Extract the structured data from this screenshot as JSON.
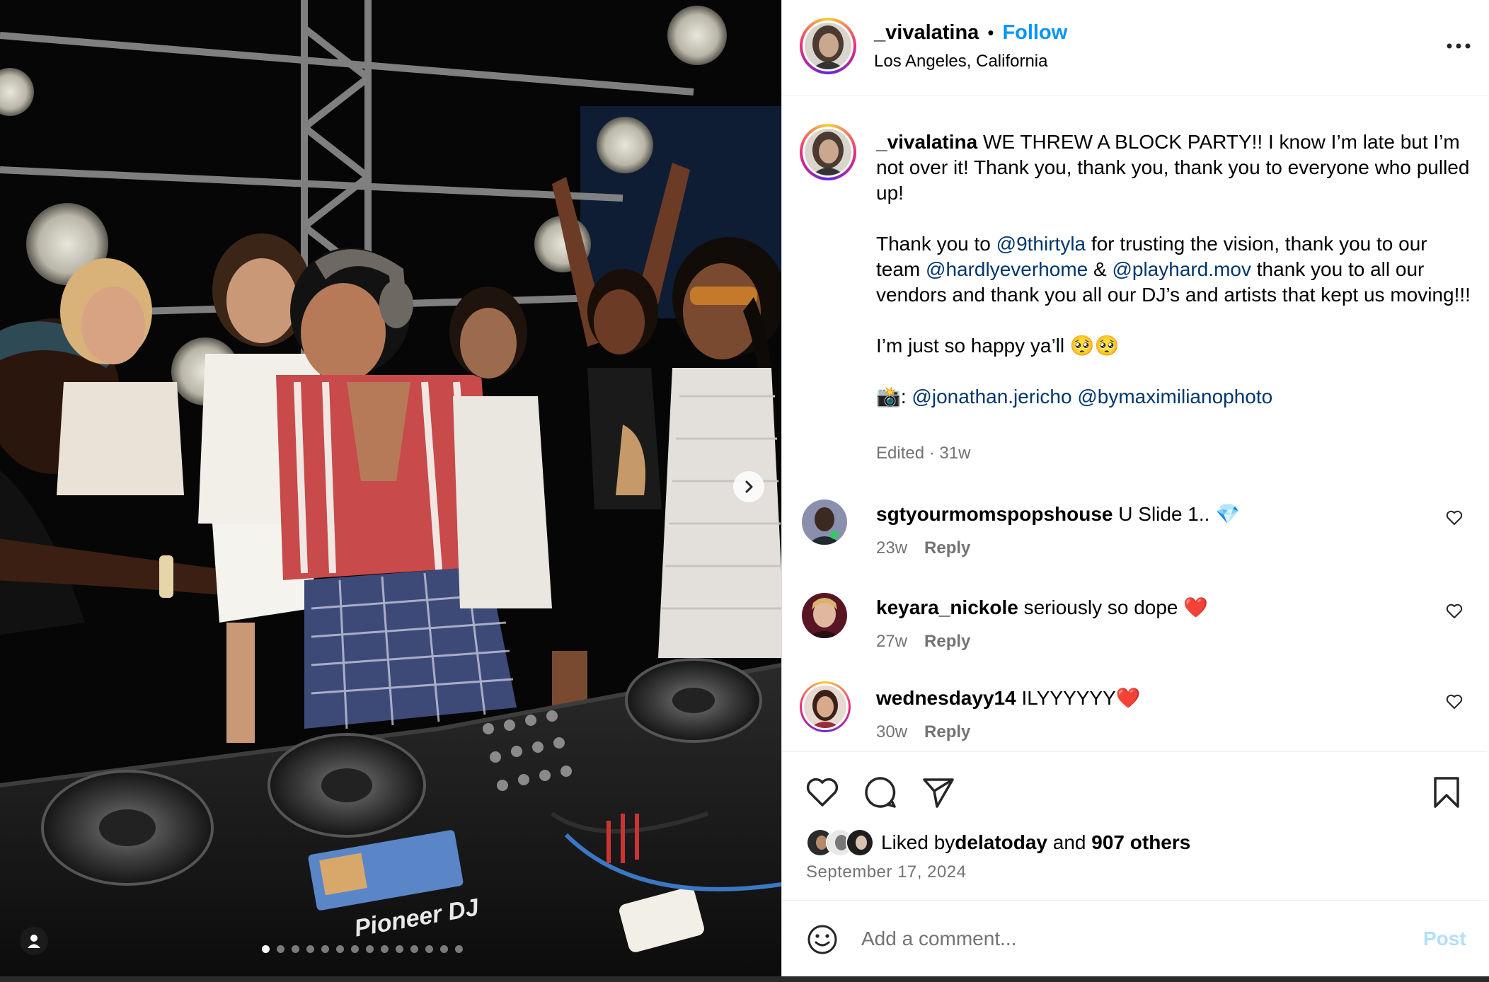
{
  "post": {
    "username": "_vivalatina",
    "separator": "•",
    "follow_label": "Follow",
    "location": "Los Angeles, California",
    "more_label": "More options"
  },
  "photo": {
    "carousel_count": 14,
    "active_index": 0,
    "brand_text": "Pioneer DJ"
  },
  "caption": {
    "username": "_vivalatina",
    "line1": " WE THREW A BLOCK PARTY!! I know I’m late but I’m not over it! Thank you, thank you, thank you to everyone who pulled up!",
    "p2_a": "Thank you to ",
    "m1": "@9thirtyla",
    "p2_b": " for trusting the vision, thank you to our team ",
    "m2": "@hardlyeverhome",
    "p2_c": " & ",
    "m3": "@playhard.mov",
    "p2_d": " thank you to all our vendors and thank you all our DJ’s and artists that kept us moving!!!",
    "p3": "I’m just so happy ya’ll 🥺🥺",
    "p4_prefix": "📸: ",
    "m4": "@jonathan.jericho",
    "p4_space": " ",
    "m5": "@bymaximilianophoto",
    "edited": "Edited · 31w"
  },
  "comments": [
    {
      "username": "sgtyourmomspopshouse",
      "text": " U Slide 1.. 💎",
      "age": "23w",
      "reply": "Reply"
    },
    {
      "username": "keyara_nickole",
      "text": " seriously so dope ❤️",
      "age": "27w",
      "reply": "Reply"
    },
    {
      "username": "wednesdayy14",
      "text": " ILYYYYYY❤️",
      "age": "30w",
      "reply": "Reply"
    }
  ],
  "likes": {
    "prefix": "Liked by ",
    "user": "delatoday",
    "and": " and ",
    "others": "907 others",
    "date": "September 17, 2024"
  },
  "composer": {
    "placeholder": "Add a comment...",
    "post_label": "Post"
  },
  "colors": {
    "link_blue": "#0095f6",
    "mention_blue": "#00376b",
    "muted": "#737373",
    "post_disabled": "#b2dffc"
  }
}
